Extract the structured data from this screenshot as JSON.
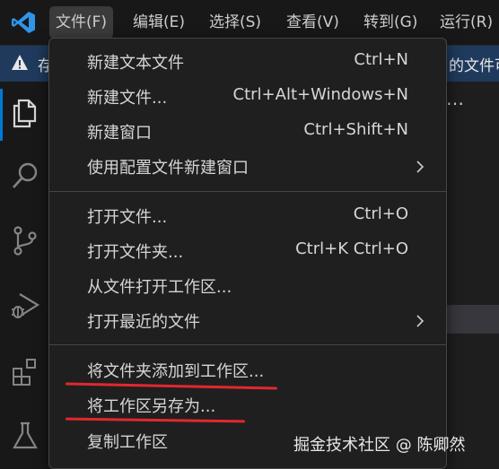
{
  "menubar": {
    "items": [
      {
        "label": "文件(F)"
      },
      {
        "label": "编辑(E)"
      },
      {
        "label": "选择(S)"
      },
      {
        "label": "查看(V)"
      },
      {
        "label": "转到(G)"
      },
      {
        "label": "运行(R)"
      }
    ]
  },
  "notification": {
    "text_left": "存",
    "text_right": "的文件可"
  },
  "activity_bar": {
    "icons": [
      "explorer-icon",
      "search-icon",
      "source-control-icon",
      "run-debug-icon",
      "extensions-icon",
      "testing-icon"
    ]
  },
  "ellipsis": "…",
  "file_menu": {
    "groups": [
      [
        {
          "label": "新建文本文件",
          "shortcut": "Ctrl+N"
        },
        {
          "label": "新建文件...",
          "shortcut": "Ctrl+Alt+Windows+N"
        },
        {
          "label": "新建窗口",
          "shortcut": "Ctrl+Shift+N"
        },
        {
          "label": "使用配置文件新建窗口",
          "shortcut": "",
          "submenu": true
        }
      ],
      [
        {
          "label": "打开文件...",
          "shortcut": "Ctrl+O"
        },
        {
          "label": "打开文件夹...",
          "shortcut": "Ctrl+K Ctrl+O"
        },
        {
          "label": "从文件打开工作区...",
          "shortcut": ""
        },
        {
          "label": "打开最近的文件",
          "shortcut": "",
          "submenu": true
        }
      ],
      [
        {
          "label": "将文件夹添加到工作区...",
          "shortcut": "",
          "underlined": true
        },
        {
          "label": "将工作区另存为...",
          "shortcut": "",
          "underlined": true
        },
        {
          "label": "复制工作区",
          "shortcut": ""
        }
      ]
    ]
  },
  "watermark": "掘金技术社区 @ 陈卿然",
  "colors": {
    "accent": "#0078d4",
    "annotation_red": "#e0282e",
    "menu_bg": "#1f1f1f"
  }
}
